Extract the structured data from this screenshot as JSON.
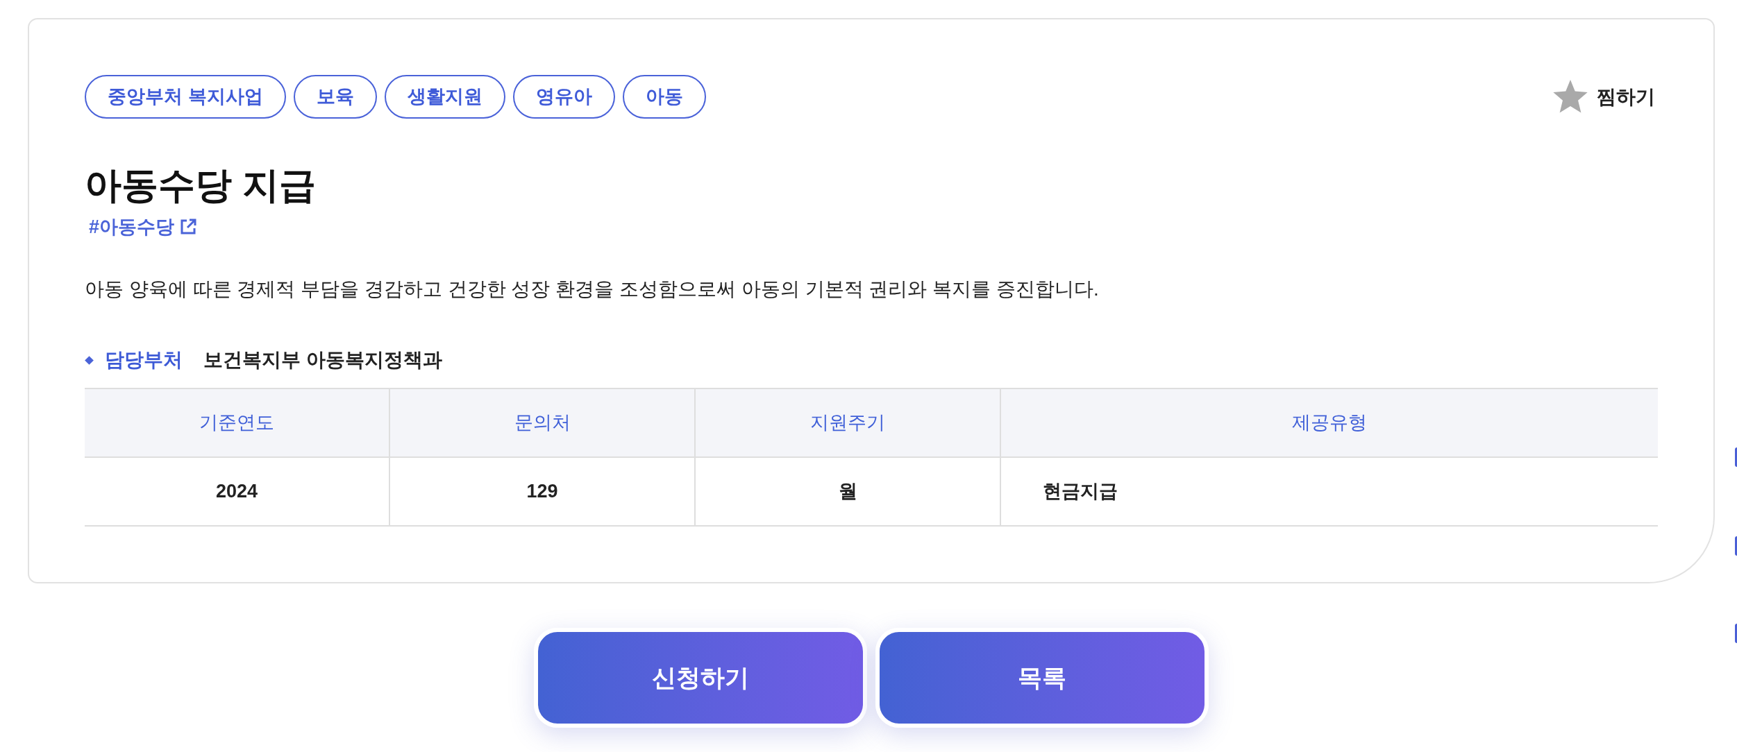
{
  "tags": [
    "중앙부처 복지사업",
    "보육",
    "생활지원",
    "영유아",
    "아동"
  ],
  "bookmark": {
    "label": "찜하기",
    "on": false
  },
  "title": "아동수당 지급",
  "hashtag": "#아동수당",
  "description": "아동 양육에 따른 경제적 부담을 경감하고 건강한 성장 환경을 조성함으로써 아동의 기본적 권리와 복지를 증진합니다.",
  "department": {
    "label": "담당부처",
    "value": "보건복지부 아동복지정책과"
  },
  "table": {
    "columns": [
      "기준연도",
      "문의처",
      "지원주기",
      "제공유형"
    ],
    "rows": [
      [
        "2024",
        "129",
        "월",
        "현금지급"
      ]
    ]
  },
  "buttons": [
    "신청하기",
    "목록"
  ]
}
